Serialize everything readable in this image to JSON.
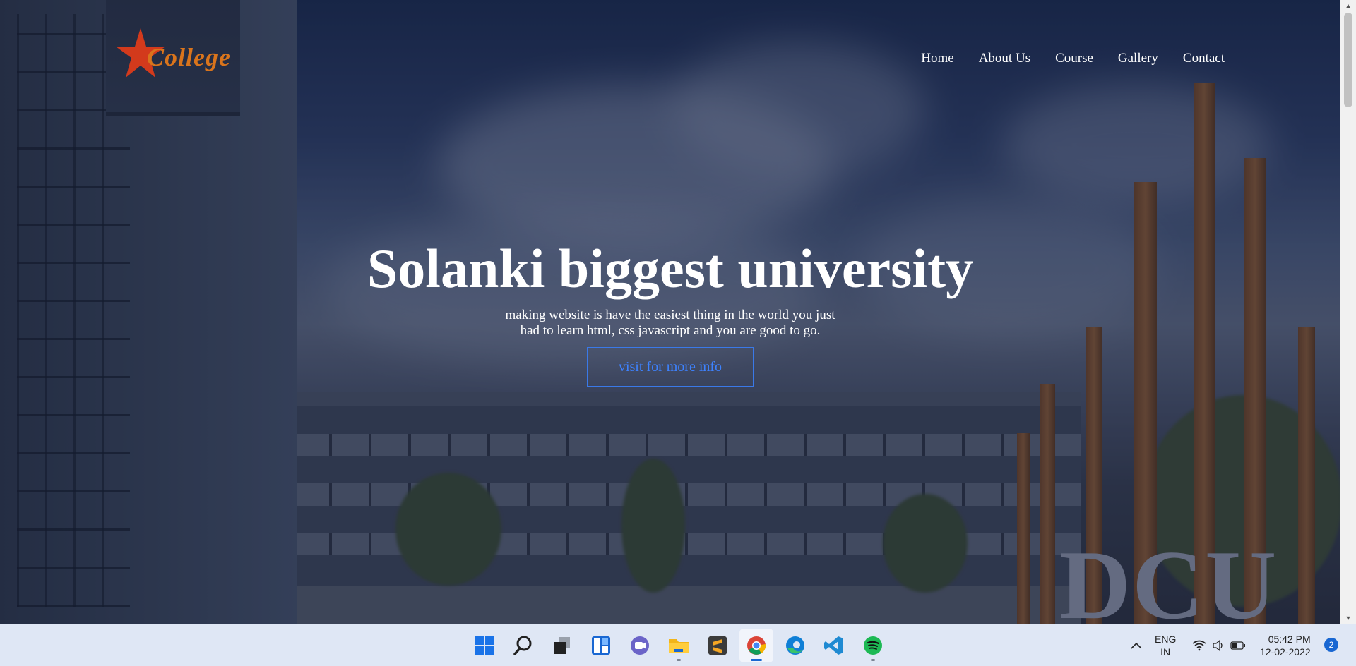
{
  "brand": {
    "logo_text": "College"
  },
  "nav": {
    "items": [
      "Home",
      "About Us",
      "Course",
      "Gallery",
      "Contact"
    ]
  },
  "hero": {
    "title": "Solanki biggest university",
    "subtitle": "making website is have the easiest thing in the world you just had to learn html, css javascript and you are good to go.",
    "cta_label": "visit for more info",
    "background_sign": "DCU"
  },
  "taskbar": {
    "apps": [
      "start-icon",
      "search-icon",
      "task-view-icon",
      "widgets-icon",
      "teams-chat-icon",
      "file-explorer-icon",
      "sublime-text-icon",
      "chrome-icon",
      "edge-icon",
      "vscode-icon",
      "spotify-icon"
    ],
    "active_app": "chrome-icon",
    "language": {
      "line1": "ENG",
      "line2": "IN"
    },
    "time": "05:42 PM",
    "date": "12-02-2022",
    "notification_count": "2"
  },
  "colors": {
    "accent": "#3d82ff",
    "logo": "#d9741c",
    "taskbar": "#dfe7f5"
  }
}
